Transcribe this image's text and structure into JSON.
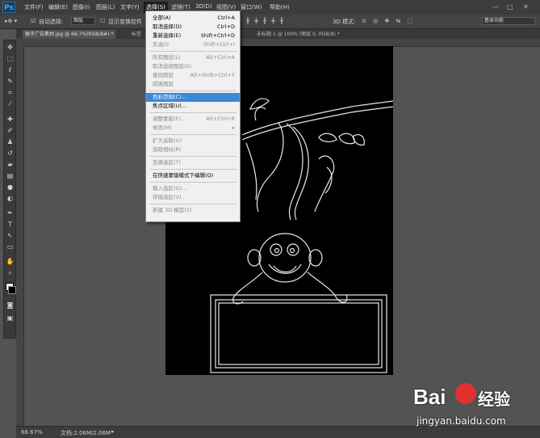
{
  "app": {
    "logo": "Ps"
  },
  "menubar": {
    "items": [
      "文件(F)",
      "编辑(E)",
      "图像(I)",
      "图层(L)",
      "文字(Y)",
      "选择(S)",
      "滤镜(T)",
      "3D(D)",
      "视图(V)",
      "窗口(W)",
      "帮助(H)"
    ],
    "active": "选择(S)",
    "window_controls": [
      "—",
      "□",
      "✕"
    ]
  },
  "options_bar": {
    "auto_select_label": "自动选择:",
    "auto_select_value": "图层",
    "show_transform_label": "显示变换控件",
    "mode_3d_label": "3D 模式:",
    "workspace": "基本功能"
  },
  "tabs": [
    {
      "label": "猴子广告素材.jpg @ 66.7%(RGB/8#) *",
      "active": true
    },
    {
      "label": "标签",
      "active": false
    },
    {
      "label": "未标题-1 @ 100% (图层 0, RGB/8) *",
      "active": false
    }
  ],
  "select_menu": {
    "items": [
      {
        "label": "全部(A)",
        "shortcut": "Ctrl+A",
        "enabled": true
      },
      {
        "label": "取消选择(D)",
        "shortcut": "Ctrl+D",
        "enabled": true
      },
      {
        "label": "重新选择(E)",
        "shortcut": "Shift+Ctrl+D",
        "enabled": true
      },
      {
        "label": "反选(I)",
        "shortcut": "Shift+Ctrl+I",
        "enabled": false
      },
      {
        "sep": true
      },
      {
        "label": "所有图层(L)",
        "shortcut": "Alt+Ctrl+A",
        "enabled": false
      },
      {
        "label": "取消选择图层(S)",
        "shortcut": "",
        "enabled": false
      },
      {
        "label": "查找图层",
        "shortcut": "Alt+Shift+Ctrl+F",
        "enabled": false
      },
      {
        "label": "隔离图层",
        "shortcut": "",
        "enabled": false
      },
      {
        "sep": true
      },
      {
        "label": "色彩范围(C)...",
        "shortcut": "",
        "enabled": true,
        "highlighted": true
      },
      {
        "label": "焦点区域(U)...",
        "shortcut": "",
        "enabled": true
      },
      {
        "sep": true
      },
      {
        "label": "调整蒙版(F)...",
        "shortcut": "Alt+Ctrl+R",
        "enabled": false
      },
      {
        "label": "修改(M)",
        "shortcut": "▸",
        "enabled": false
      },
      {
        "sep": true
      },
      {
        "label": "扩大选取(G)",
        "shortcut": "",
        "enabled": false
      },
      {
        "label": "选取相似(R)",
        "shortcut": "",
        "enabled": false
      },
      {
        "sep": true
      },
      {
        "label": "变换选区(T)",
        "shortcut": "",
        "enabled": false
      },
      {
        "sep": true
      },
      {
        "label": "在快速蒙版模式下编辑(Q)",
        "shortcut": "",
        "enabled": true
      },
      {
        "sep": true
      },
      {
        "label": "载入选区(O)...",
        "shortcut": "",
        "enabled": false
      },
      {
        "label": "存储选区(V)...",
        "shortcut": "",
        "enabled": false
      },
      {
        "sep": true
      },
      {
        "label": "新建 3D 模型(3)",
        "shortcut": "",
        "enabled": false
      }
    ]
  },
  "status": {
    "zoom": "66.67%",
    "doc_size": "文档:2.06M/2.06M"
  },
  "watermark": {
    "brand": "Bai",
    "brand2": "经验",
    "url": "jingyan.baidu.com"
  },
  "colors": {
    "menu_highlight": "#3a88d6",
    "canvas": "#000000",
    "workspace": "#535353"
  }
}
